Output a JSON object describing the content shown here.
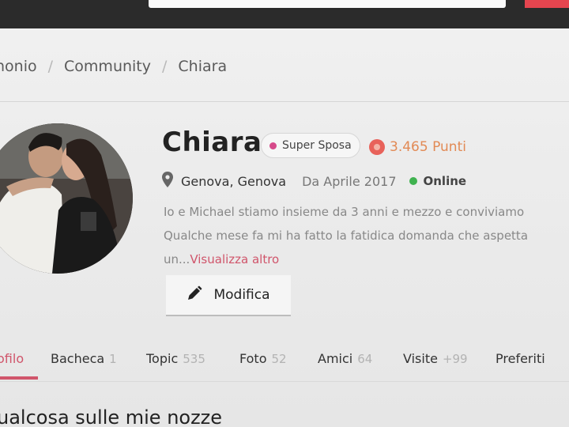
{
  "breadcrumb": {
    "items": [
      "nonio",
      "Community",
      "Chiara"
    ],
    "separator": "/"
  },
  "profile": {
    "name": "Chiara",
    "badge": "Super Sposa",
    "points": "3.465 Punti",
    "location": "Genova, Genova",
    "member_since": "Da Aprile 2017",
    "status": "Online",
    "bio_line1": "Io e Michael stiamo insieme da 3 anni e mezzo e conviviamo",
    "bio_line2": "Qualche mese fa mi ha fatto la fatidica domanda che aspetta",
    "bio_line3_prefix": "un",
    "bio_ellipsis": "...",
    "bio_more": "Visualizza altro"
  },
  "actions": {
    "edit_label": "Modifica"
  },
  "tabs": [
    {
      "label": "ofilo",
      "count": ""
    },
    {
      "label": "Bacheca",
      "count": "1"
    },
    {
      "label": "Topic",
      "count": "535"
    },
    {
      "label": "Foto",
      "count": "52"
    },
    {
      "label": "Amici",
      "count": "64"
    },
    {
      "label": "Visite",
      "count": "+99"
    },
    {
      "label": "Preferiti",
      "count": ""
    }
  ],
  "section": {
    "title": "ualcosa sulle mie nozze"
  },
  "colors": {
    "accent": "#d0556b",
    "badge_dot": "#d64a8a",
    "online": "#3fb24f",
    "points": "#e28a55",
    "header": "#2b2b2b"
  },
  "icons": {
    "location": "map-pin-icon",
    "edit": "pencil-icon",
    "points": "points-icon"
  }
}
